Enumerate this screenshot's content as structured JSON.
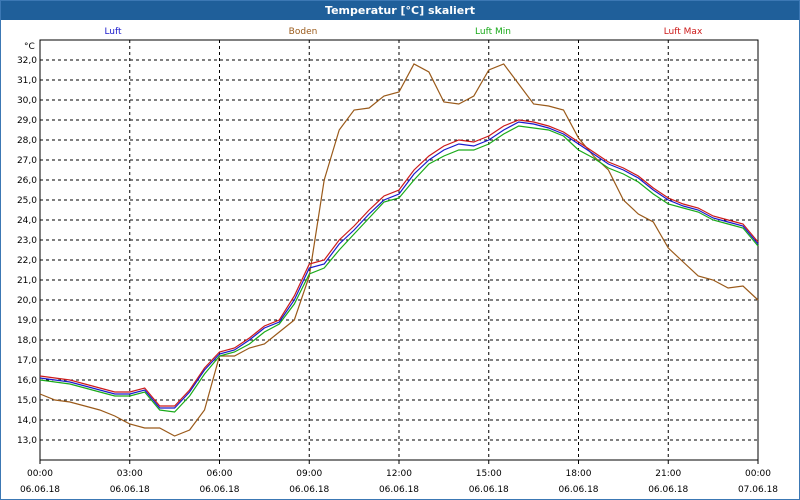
{
  "window": {
    "title": "Temperatur [°C] skaliert"
  },
  "chart_data": {
    "type": "line",
    "title": "Temperatur [°C] skaliert",
    "ylabel": "°C",
    "xlabel": "",
    "ylim": [
      12.0,
      33.0
    ],
    "xlim": [
      0,
      24
    ],
    "grid": true,
    "legend": "top",
    "y_ticks": [
      "13,0",
      "14,0",
      "15,0",
      "16,0",
      "17,0",
      "18,0",
      "19,0",
      "20,0",
      "21,0",
      "22,0",
      "23,0",
      "24,0",
      "25,0",
      "26,0",
      "27,0",
      "28,0",
      "29,0",
      "30,0",
      "31,0",
      "32,0"
    ],
    "x_ticks": [
      {
        "time": "00:00",
        "date": "06.06.18"
      },
      {
        "time": "03:00",
        "date": "06.06.18"
      },
      {
        "time": "06:00",
        "date": "06.06.18"
      },
      {
        "time": "09:00",
        "date": "06.06.18"
      },
      {
        "time": "12:00",
        "date": "06.06.18"
      },
      {
        "time": "15:00",
        "date": "06.06.18"
      },
      {
        "time": "18:00",
        "date": "06.06.18"
      },
      {
        "time": "21:00",
        "date": "06.06.18"
      },
      {
        "time": "00:00",
        "date": "07.06.18"
      }
    ],
    "x": [
      0,
      0.5,
      1,
      1.5,
      2,
      2.5,
      3,
      3.5,
      4,
      4.5,
      5,
      5.5,
      6,
      6.5,
      7,
      7.5,
      8,
      8.5,
      9,
      9.5,
      10,
      10.5,
      11,
      11.5,
      12,
      12.5,
      13,
      13.5,
      14,
      14.5,
      15,
      15.5,
      16,
      16.5,
      17,
      17.5,
      18,
      18.5,
      19,
      19.5,
      20,
      20.5,
      21,
      21.5,
      22,
      22.5,
      23,
      23.5,
      24
    ],
    "series": [
      {
        "name": "Luft",
        "color": "#1a1acc",
        "values": [
          16.1,
          16.0,
          15.9,
          15.7,
          15.5,
          15.3,
          15.3,
          15.5,
          14.6,
          14.6,
          15.4,
          16.5,
          17.3,
          17.5,
          18.0,
          18.6,
          18.9,
          20.0,
          21.6,
          21.8,
          22.8,
          23.5,
          24.3,
          25.0,
          25.3,
          26.3,
          27.0,
          27.5,
          27.8,
          27.7,
          28.0,
          28.5,
          28.9,
          28.8,
          28.6,
          28.3,
          27.8,
          27.3,
          26.8,
          26.5,
          26.1,
          25.5,
          25.0,
          24.7,
          24.5,
          24.1,
          23.9,
          23.7,
          22.8
        ]
      },
      {
        "name": "Boden",
        "color": "#9a5a1a",
        "values": [
          15.3,
          15.0,
          14.9,
          14.7,
          14.5,
          14.2,
          13.8,
          13.6,
          13.6,
          13.2,
          13.5,
          14.5,
          17.2,
          17.2,
          17.6,
          17.8,
          18.4,
          19.0,
          21.2,
          26.0,
          28.5,
          29.5,
          29.6,
          30.2,
          30.4,
          31.8,
          31.4,
          29.9,
          29.8,
          30.2,
          31.5,
          31.8,
          30.8,
          29.8,
          29.7,
          29.5,
          28.1,
          27.2,
          26.5,
          25.0,
          24.3,
          23.9,
          22.6,
          21.9,
          21.2,
          21.0,
          20.6,
          20.7,
          20.0
        ]
      },
      {
        "name": "Luft Min",
        "color": "#1aaa1a",
        "values": [
          16.0,
          15.9,
          15.8,
          15.6,
          15.4,
          15.2,
          15.2,
          15.4,
          14.5,
          14.4,
          15.2,
          16.3,
          17.2,
          17.4,
          17.8,
          18.4,
          18.8,
          19.8,
          21.3,
          21.6,
          22.5,
          23.3,
          24.1,
          24.9,
          25.1,
          26.0,
          26.8,
          27.2,
          27.5,
          27.5,
          27.8,
          28.3,
          28.7,
          28.6,
          28.5,
          28.2,
          27.5,
          27.1,
          26.6,
          26.3,
          25.9,
          25.3,
          24.8,
          24.6,
          24.4,
          24.0,
          23.8,
          23.6,
          22.7
        ]
      },
      {
        "name": "Luft Max",
        "color": "#cc1a1a",
        "values": [
          16.2,
          16.1,
          16.0,
          15.8,
          15.6,
          15.4,
          15.4,
          15.6,
          14.7,
          14.7,
          15.5,
          16.6,
          17.4,
          17.6,
          18.1,
          18.7,
          19.0,
          20.2,
          21.8,
          22.0,
          23.0,
          23.7,
          24.5,
          25.2,
          25.5,
          26.5,
          27.2,
          27.7,
          28.0,
          27.9,
          28.2,
          28.7,
          29.0,
          28.9,
          28.7,
          28.4,
          27.9,
          27.4,
          26.9,
          26.6,
          26.2,
          25.6,
          25.1,
          24.8,
          24.6,
          24.2,
          24.0,
          23.8,
          22.9
        ]
      }
    ]
  }
}
